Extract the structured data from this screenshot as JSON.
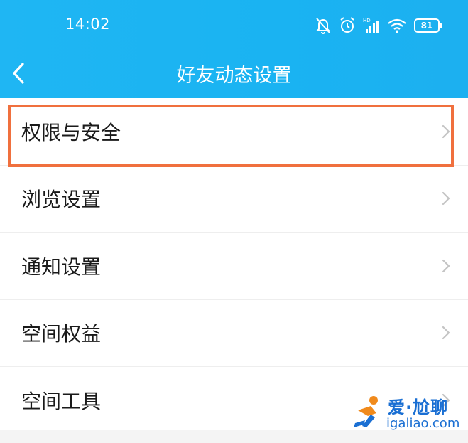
{
  "status_bar": {
    "time": "14:02",
    "battery": "81",
    "icons": [
      "mute-bell-icon",
      "alarm-icon",
      "hd-signal-icon",
      "wifi-icon",
      "battery-icon"
    ]
  },
  "nav": {
    "back_icon": "chevron-left-icon",
    "title": "好友动态设置"
  },
  "menu": {
    "items": [
      {
        "label": "权限与安全",
        "highlighted": true
      },
      {
        "label": "浏览设置"
      },
      {
        "label": "通知设置"
      },
      {
        "label": "空间权益"
      },
      {
        "label": "空间工具"
      }
    ]
  },
  "watermark": {
    "title": "爱·尬聊",
    "url": "igaliao.com"
  },
  "colors": {
    "header": "#1cb3f2",
    "highlight_border": "#f0703e",
    "watermark_blue": "#1a6fd3",
    "watermark_orange": "#f08a1c"
  }
}
